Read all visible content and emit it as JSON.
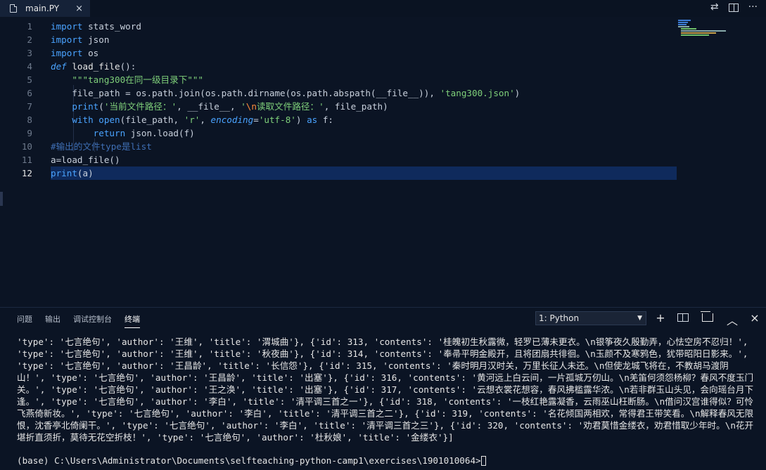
{
  "tab": {
    "filename": "main.PY",
    "close": "×",
    "file_icon": "file-icon"
  },
  "top_actions": {
    "compare": "⇄",
    "split": "split-editor-icon",
    "more": "···"
  },
  "editor": {
    "lines": [
      {
        "n": "1",
        "parts": [
          [
            "kw",
            "import"
          ],
          [
            "op",
            " stats_word"
          ]
        ]
      },
      {
        "n": "2",
        "parts": [
          [
            "kw",
            "import"
          ],
          [
            "op",
            " json"
          ]
        ]
      },
      {
        "n": "3",
        "parts": [
          [
            "kw",
            "import"
          ],
          [
            "op",
            " os"
          ]
        ]
      },
      {
        "n": "4",
        "parts": [
          [
            "kwi",
            "def"
          ],
          [
            "op",
            " "
          ],
          [
            "fn",
            "load_file"
          ],
          [
            "op",
            "():"
          ]
        ]
      },
      {
        "n": "5",
        "parts": [
          [
            "op",
            "    "
          ],
          [
            "str",
            "\"\"\"tang300在同一级目录下\"\"\""
          ]
        ]
      },
      {
        "n": "6",
        "parts": [
          [
            "op",
            "    file_path = os.path.join(os.path.dirname(os.path.abspath(__file__)), "
          ],
          [
            "str",
            "'tang300.json'"
          ],
          [
            "op",
            ")"
          ]
        ]
      },
      {
        "n": "7",
        "parts": [
          [
            "op",
            "    "
          ],
          [
            "kw",
            "print"
          ],
          [
            "op",
            "("
          ],
          [
            "str",
            "'当前文件路径：'"
          ],
          [
            "op",
            ", __file__, "
          ],
          [
            "str",
            "'"
          ],
          [
            "esc",
            "\\n"
          ],
          [
            "str",
            "读取文件路径：'"
          ],
          [
            "op",
            ", file_path)"
          ]
        ]
      },
      {
        "n": "8",
        "parts": [
          [
            "op",
            "    "
          ],
          [
            "kw",
            "with"
          ],
          [
            "op",
            " "
          ],
          [
            "kw",
            "open"
          ],
          [
            "op",
            "(file_path, "
          ],
          [
            "str",
            "'r'"
          ],
          [
            "op",
            ", "
          ],
          [
            "prm",
            "encoding"
          ],
          [
            "op",
            "="
          ],
          [
            "str",
            "'utf-8'"
          ],
          [
            "op",
            ") "
          ],
          [
            "kw",
            "as"
          ],
          [
            "op",
            " f:"
          ]
        ]
      },
      {
        "n": "9",
        "parts": [
          [
            "op",
            "        "
          ],
          [
            "kw",
            "return"
          ],
          [
            "op",
            " json.load(f)"
          ]
        ]
      },
      {
        "n": "10",
        "parts": [
          [
            "cmt",
            "#输出的文件type是list"
          ]
        ]
      },
      {
        "n": "11",
        "parts": [
          [
            "op",
            "a=load_file()"
          ]
        ]
      },
      {
        "n": "12",
        "parts": [
          [
            "kw",
            "print"
          ],
          [
            "op",
            "("
          ],
          [
            "op",
            "a"
          ],
          [
            "op",
            ")"
          ]
        ]
      }
    ],
    "current_line": "12"
  },
  "panel": {
    "tabs": [
      "问题",
      "输出",
      "调试控制台",
      "终端"
    ],
    "active_tab": "终端",
    "terminal_select": "1: Python",
    "icons": {
      "add": "+",
      "maximize": "^",
      "close": "×"
    },
    "output": "'type': '七言绝句', 'author': '王维', 'title': '渭城曲'}, {'id': 313, 'contents': '桂魄初生秋露微，轻罗已薄未更衣。\\n银筝夜久殷勤弄，心怯空房不忍归！', 'type': '七言绝句', 'author': '王维', 'title': '秋夜曲'}, {'id': 314, 'contents': '奉帚平明金殿开，且将团扇共徘徊。\\n玉颜不及寒鸦色，犹带昭阳日影来。', 'type': '七言绝句', 'author': '王昌龄', 'title': '长信怨'}, {'id': 315, 'contents': '秦时明月汉时关，万里长征人未还。\\n但使龙城飞将在，不教胡马渡阴山！', 'type': '七言绝句', 'author': '王昌龄', 'title': '出塞'}, {'id': 316, 'contents': '黄河远上白云间，一片孤城万仞山。\\n羌笛何须怨杨柳？春风不度玉门关。', 'type': '七言绝句', 'author': '王之涣', 'title': '出塞'}, {'id': 317, 'contents': '云想衣裳花想容，春风拂槛露华浓。\\n若非群玉山头见，会向瑶台月下逢。', 'type': '七言绝句', 'author': '李白', 'title': '清平调三首之一'}, {'id': 318, 'contents': '一枝红艳露凝香，云雨巫山枉断肠。\\n借问汉宫谁得似？可怜飞燕倚新妆。', 'type': '七言绝句', 'author': '李白', 'title': '清平调三首之二'}, {'id': 319, 'contents': '名花倾国两相欢，常得君王带笑看。\\n解释春风无限恨，沈香亭北倚阑干。', 'type': '七言绝句', 'author': '李白', 'title': '清平调三首之三'}, {'id': 320, 'contents': '劝君莫惜金缕衣，劝君惜取少年时。\\n花开堪折直须折，莫待无花空折枝！', 'type': '七言绝句', 'author': '杜秋娘', 'title': '金缕衣'}]",
    "prompt": "(base) C:\\Users\\Administrator\\Documents\\selfteaching-python-camp1\\exercises\\1901010064>"
  }
}
